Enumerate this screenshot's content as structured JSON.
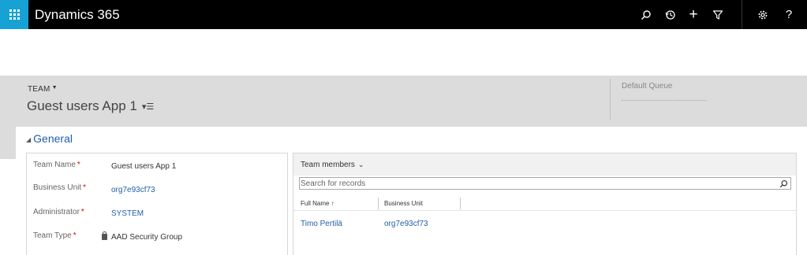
{
  "nav": {
    "app_title": "Dynamics 365",
    "icons": [
      "search-icon",
      "history-icon",
      "plus-icon",
      "filter-icon",
      "gear-icon",
      "help-icon"
    ],
    "help_glyph": "?",
    "plus_glyph": "+"
  },
  "header": {
    "entity_type": "TEAM",
    "record_title": "Guest users App 1",
    "default_queue_label": "Default Queue"
  },
  "section": {
    "title": "General"
  },
  "fields": [
    {
      "label": "Team Name",
      "value": "Guest users App 1"
    },
    {
      "label": "Business Unit",
      "value": "org7e93cf73"
    },
    {
      "label": "Administrator",
      "value": "SYSTEM"
    },
    {
      "label": "Team Type",
      "value": "AAD Security Group"
    }
  ],
  "required_marker": "*",
  "subgrid": {
    "title": "Team members",
    "search_placeholder": "Search for records",
    "columns": [
      "Full Name",
      "Business Unit"
    ],
    "sort_arrow": "↑",
    "rows": [
      {
        "full_name": "Timo Pertilä",
        "business_unit": "org7e93cf73"
      }
    ]
  },
  "colors": {
    "waffle": "#17a2d6",
    "topbar": "#000000",
    "header_band": "#dcdcdc",
    "link": "#1f5faa",
    "required": "#dd0000"
  }
}
